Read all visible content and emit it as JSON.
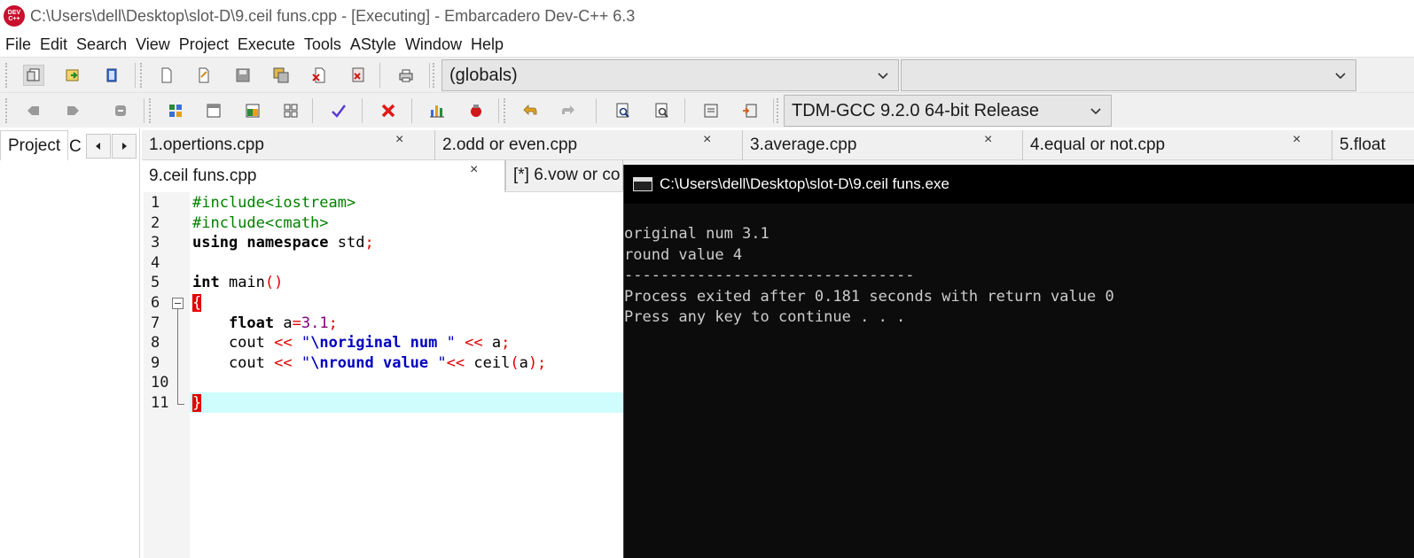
{
  "window": {
    "logo_top": "DEV",
    "logo_bottom": "C++",
    "title": "C:\\Users\\dell\\Desktop\\slot-D\\9.ceil funs.cpp - [Executing] - Embarcadero Dev-C++ 6.3"
  },
  "menu": [
    "File",
    "Edit",
    "Search",
    "View",
    "Project",
    "Execute",
    "Tools",
    "AStyle",
    "Window",
    "Help"
  ],
  "toolbar": {
    "scope_combo": "(globals)",
    "member_combo": "",
    "compiler_combo": "TDM-GCC 9.2.0 64-bit Release"
  },
  "left_panel": {
    "project_tab": "Project",
    "classes_tab": "C"
  },
  "editor_tabs": {
    "row1": [
      {
        "label": "1.opertions.cpp"
      },
      {
        "label": "2.odd or even.cpp"
      },
      {
        "label": "3.average.cpp"
      },
      {
        "label": "4.equal or not.cpp"
      },
      {
        "label": "5.float"
      }
    ],
    "row2": [
      {
        "label": "9.ceil funs.cpp",
        "active": true
      },
      {
        "label": "[*] 6.vow or co"
      }
    ],
    "close_glyph": "×"
  },
  "editor": {
    "line_numbers": [
      "1",
      "2",
      "3",
      "4",
      "5",
      "6",
      "7",
      "8",
      "9",
      "10",
      "11"
    ],
    "lines": [
      [
        {
          "t": "#include<iostream>",
          "c": "pp"
        }
      ],
      [
        {
          "t": "#include<cmath>",
          "c": "pp"
        }
      ],
      [
        {
          "t": "using namespace",
          "c": "kw"
        },
        {
          "t": " std",
          "c": ""
        },
        {
          "t": ";",
          "c": "sym"
        }
      ],
      [],
      [
        {
          "t": "int",
          "c": "kw"
        },
        {
          "t": " main",
          "c": ""
        },
        {
          "t": "()",
          "c": "sym"
        }
      ],
      [
        {
          "t": "{",
          "c": "brace"
        }
      ],
      [
        {
          "t": "    ",
          "c": ""
        },
        {
          "t": "float",
          "c": "kw"
        },
        {
          "t": " a",
          "c": ""
        },
        {
          "t": "=",
          "c": "sym"
        },
        {
          "t": "3.1",
          "c": "num"
        },
        {
          "t": ";",
          "c": "sym"
        }
      ],
      [
        {
          "t": "    cout ",
          "c": ""
        },
        {
          "t": "<<",
          "c": "sym"
        },
        {
          "t": " \"",
          "c": "str"
        },
        {
          "t": "\\noriginal num",
          "c": "strb"
        },
        {
          "t": " \" ",
          "c": "str"
        },
        {
          "t": "<<",
          "c": "sym"
        },
        {
          "t": " a",
          "c": ""
        },
        {
          "t": ";",
          "c": "sym"
        }
      ],
      [
        {
          "t": "    cout ",
          "c": ""
        },
        {
          "t": "<<",
          "c": "sym"
        },
        {
          "t": " \"",
          "c": "str"
        },
        {
          "t": "\\nround value",
          "c": "strb"
        },
        {
          "t": " \"",
          "c": "str"
        },
        {
          "t": "<<",
          "c": "sym"
        },
        {
          "t": " ceil",
          "c": ""
        },
        {
          "t": "(",
          "c": "sym"
        },
        {
          "t": "a",
          "c": ""
        },
        {
          "t": ");",
          "c": "sym"
        }
      ],
      [],
      [
        {
          "t": "}",
          "c": "brace"
        }
      ]
    ]
  },
  "console": {
    "title": "C:\\Users\\dell\\Desktop\\slot-D\\9.ceil funs.exe",
    "lines": [
      "original num 3.1",
      "round value 4",
      "--------------------------------",
      "Process exited after 0.181 seconds with return value 0",
      "Press any key to continue . . ."
    ]
  }
}
